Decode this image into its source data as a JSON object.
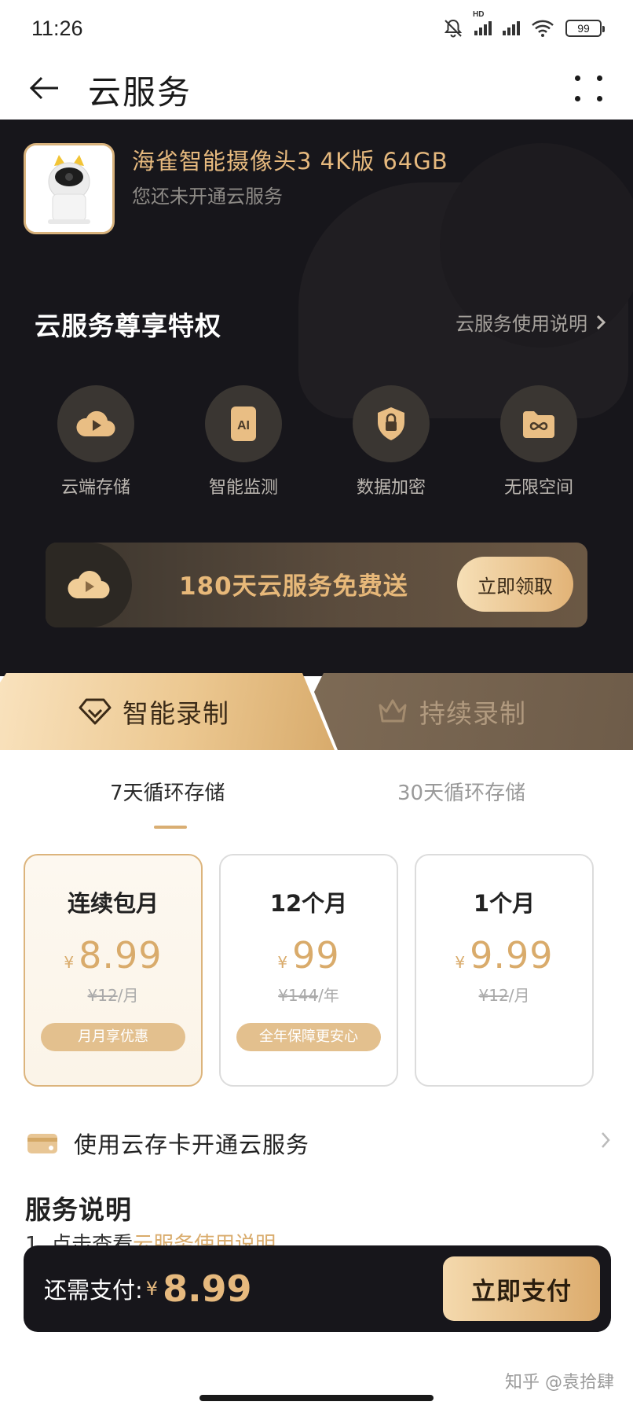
{
  "status_bar": {
    "time": "11:26",
    "battery": "99",
    "network_label": "HD"
  },
  "header": {
    "title": "云服务"
  },
  "device": {
    "name": "海雀智能摄像头3 4K版 64GB",
    "status": "您还未开通云服务"
  },
  "privileges": {
    "title": "云服务尊享特权",
    "link": "云服务使用说明",
    "items": [
      {
        "label": "云端存储",
        "icon": "cloud-play-icon"
      },
      {
        "label": "智能监测",
        "icon": "ai-icon"
      },
      {
        "label": "数据加密",
        "icon": "lock-shield-icon"
      },
      {
        "label": "无限空间",
        "icon": "infinity-folder-icon"
      }
    ]
  },
  "promo": {
    "text": "180天云服务免费送",
    "button": "立即领取"
  },
  "plan_tabs": [
    {
      "label": "智能录制",
      "icon": "diamond-icon",
      "active": true
    },
    {
      "label": "持续录制",
      "icon": "crown-icon",
      "active": false
    }
  ],
  "storage_tabs": [
    {
      "label": "7天循环存储",
      "active": true
    },
    {
      "label": "30天循环存储",
      "active": false
    }
  ],
  "plans": [
    {
      "name": "连续包月",
      "currency": "¥",
      "price": "8.99",
      "original": "¥12",
      "unit": "/月",
      "badge": "月月享优惠",
      "selected": true
    },
    {
      "name": "12个月",
      "currency": "¥",
      "price": "99",
      "original": "¥144",
      "unit": "/年",
      "badge": "全年保障更安心",
      "selected": false
    },
    {
      "name": "1个月",
      "currency": "¥",
      "price": "9.99",
      "original": "¥12",
      "unit": "/月",
      "badge": "",
      "selected": false
    }
  ],
  "card_open": {
    "label": "使用云存卡开通云服务"
  },
  "service_desc": {
    "title": "服务说明",
    "line_prefix": "1. 点击查看",
    "line_link": "云服务使用说明"
  },
  "pay": {
    "label": "还需支付:",
    "currency": "¥",
    "amount": "8.99",
    "button": "立即支付"
  },
  "watermark": "知乎 @袁拾肆",
  "colors": {
    "gold": "#e6b97e",
    "dark_bg": "#17161b",
    "badge": "#e3c08e"
  }
}
